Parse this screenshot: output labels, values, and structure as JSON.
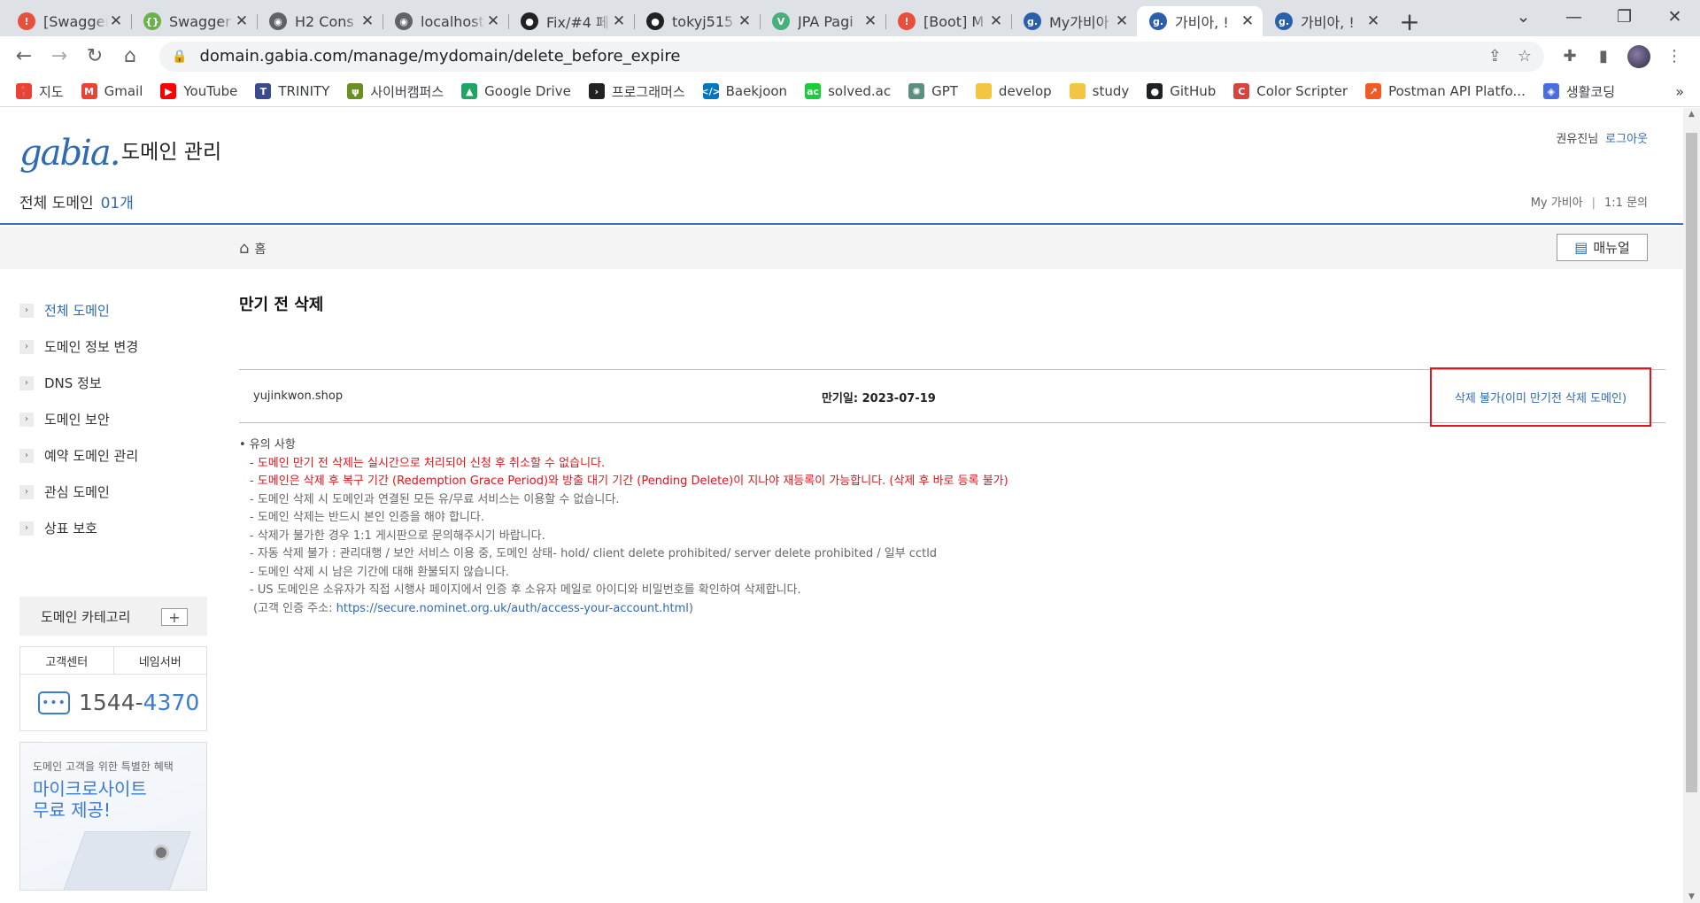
{
  "browser": {
    "tabs": [
      {
        "title": "[Swagger",
        "fav_color": "#e84f3d",
        "fav_text": "!"
      },
      {
        "title": "Swagger",
        "fav_color": "#6ab04c",
        "fav_text": "{}"
      },
      {
        "title": "H2 Cons",
        "fav_color": "#5f6368",
        "fav_text": "◉"
      },
      {
        "title": "localhost",
        "fav_color": "#5f6368",
        "fav_text": "◉"
      },
      {
        "title": "Fix/#4 페",
        "fav_color": "#202124",
        "fav_text": "●"
      },
      {
        "title": "tokyj515",
        "fav_color": "#202124",
        "fav_text": "●"
      },
      {
        "title": "JPA Pagi",
        "fav_color": "#45b07c",
        "fav_text": "V"
      },
      {
        "title": "[Boot] M",
        "fav_color": "#e84f3d",
        "fav_text": "!"
      },
      {
        "title": "My가비아",
        "fav_color": "#2b5fab",
        "fav_text": "g."
      },
      {
        "title": "가비아, !",
        "fav_color": "#2b5fab",
        "fav_text": "g."
      },
      {
        "title": "가비아, !",
        "fav_color": "#2b5fab",
        "fav_text": "g."
      }
    ],
    "active_tab_index": 9,
    "new_tab": "+",
    "url": "domain.gabia.com/manage/mydomain/delete_before_expire",
    "bookmarks": [
      {
        "label": "지도",
        "color": "#ea4335",
        "icon": "📍"
      },
      {
        "label": "Gmail",
        "color": "#ea4335",
        "icon": "M"
      },
      {
        "label": "YouTube",
        "color": "#ff0000",
        "icon": "▶"
      },
      {
        "label": "TRINITY",
        "color": "#3b4a8c",
        "icon": "T"
      },
      {
        "label": "사이버캠퍼스",
        "color": "#6b8e23",
        "icon": "ψ"
      },
      {
        "label": "Google Drive",
        "color": "#1fa463",
        "icon": "▲"
      },
      {
        "label": "프로그래머스",
        "color": "#222222",
        "icon": "›"
      },
      {
        "label": "Baekjoon",
        "color": "#0076c0",
        "icon": "</>"
      },
      {
        "label": "solved.ac",
        "color": "#17ce3a",
        "icon": "ac"
      },
      {
        "label": "GPT",
        "color": "#5c8f7f",
        "icon": "✺"
      },
      {
        "label": "develop",
        "color": "#f4c542",
        "icon": ""
      },
      {
        "label": "study",
        "color": "#f4c542",
        "icon": ""
      },
      {
        "label": "GitHub",
        "color": "#202124",
        "icon": "●"
      },
      {
        "label": "Color Scripter",
        "color": "#d6453d",
        "icon": "C"
      },
      {
        "label": "Postman API Platfo...",
        "color": "#ef5b25",
        "icon": "↗"
      },
      {
        "label": "생활코딩",
        "color": "#4a6ee0",
        "icon": "◈"
      }
    ],
    "bookmarks_more": "»"
  },
  "header": {
    "logo": "gabia",
    "title": "도메인 관리",
    "all_domains_label": "전체 도메인",
    "all_domains_count": "01개",
    "user_name": "권유진님",
    "logout": "로그아웃",
    "link_my": "My 가비아",
    "link_sep": "|",
    "link_inquiry": "1:1 문의"
  },
  "subbar": {
    "home": "홈",
    "manual": "매뉴얼"
  },
  "sidebar": {
    "items": [
      {
        "label": "전체 도메인",
        "active": true
      },
      {
        "label": "도메인 정보 변경",
        "active": false
      },
      {
        "label": "DNS 정보",
        "active": false
      },
      {
        "label": "도메인 보안",
        "active": false
      },
      {
        "label": "예약 도메인 관리",
        "active": false
      },
      {
        "label": "관심 도메인",
        "active": false
      },
      {
        "label": "상표 보호",
        "active": false
      }
    ],
    "category_label": "도메인 카테고리",
    "cs_tab1": "고객센터",
    "cs_tab2": "네임서버",
    "phone_a": "1544-",
    "phone_b": "4370",
    "promo_sub": "도메인 고객을 위한 특별한 혜택",
    "promo_line1": "마이크로사이트",
    "promo_line2": "무료 제공!"
  },
  "main": {
    "title": "만기 전 삭제",
    "domain": "yujinkwon.shop",
    "expiry_label": "만기일:",
    "expiry_date": "2023-07-19",
    "status": "삭제 불가(이미 만기전 삭제 도메인)",
    "notes_head": "• 유의 사항",
    "notes": [
      {
        "text": "- 도메인 만기 전 삭제는 실시간으로 처리되어 신청 후 취소할 수 없습니다.",
        "red": true
      },
      {
        "text": "- 도메인은 삭제 후 복구 기간 (Redemption Grace Period)와 방출 대기 기간 (Pending Delete)이 지나야 재등록이 가능합니다. (삭제 후 바로 등록 불가)",
        "red": true
      },
      {
        "text": "- 도메인 삭제 시 도메인과 연결된 모든 유/무료 서비스는 이용할 수 없습니다.",
        "red": false
      },
      {
        "text": "- 도메인 삭제는 반드시 본인 인증을 해야 합니다.",
        "red": false
      },
      {
        "text": "- 삭제가 불가한 경우 1:1 게시판으로 문의해주시기 바랍니다.",
        "red": false
      },
      {
        "text": "- 자동 삭제 불가 : 관리대행 / 보안 서비스 이용 중, 도메인 상태- hold/ client delete prohibited/ server delete prohibited / 일부 cctld",
        "red": false
      },
      {
        "text": "- 도메인 삭제 시 남은 기간에 대해 환불되지 않습니다.",
        "red": false
      },
      {
        "text": "- US 도메인은 소유자가 직접 시행사 페이지에서 인증 후 소유자 메일로 아이디와 비밀번호를 확인하여 삭제합니다.",
        "red": false
      }
    ],
    "auth_prefix": "(고객 인증 주소: ",
    "auth_url": "https://secure.nominet.org.uk/auth/access-your-account.html",
    "auth_suffix": ")"
  },
  "colors": {
    "brand_blue": "#2f6ab3",
    "warning_red": "#e0141b",
    "highlight_border": "#e5141b"
  }
}
